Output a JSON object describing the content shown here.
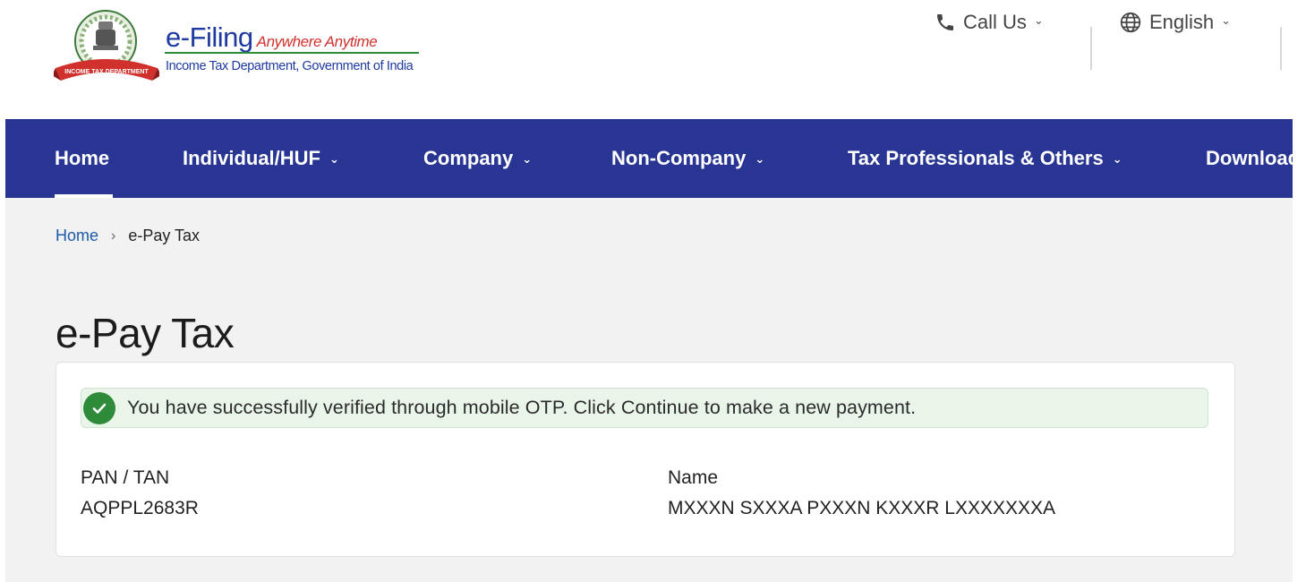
{
  "header": {
    "logo": {
      "title": "e-Filing",
      "tagline": "Anywhere Anytime",
      "subtitle": "Income Tax Department, Government of India",
      "ribbon_text": "INCOME TAX DEPARTMENT"
    },
    "actions": {
      "call_us": "Call Us",
      "language": "English"
    }
  },
  "nav": {
    "items": [
      {
        "label": "Home",
        "has_dropdown": false,
        "active": true
      },
      {
        "label": "Individual/HUF",
        "has_dropdown": true
      },
      {
        "label": "Company",
        "has_dropdown": true
      },
      {
        "label": "Non-Company",
        "has_dropdown": true
      },
      {
        "label": "Tax Professionals & Others",
        "has_dropdown": true
      },
      {
        "label": "Downloads",
        "has_dropdown": false
      }
    ]
  },
  "breadcrumb": {
    "home": "Home",
    "current": "e-Pay Tax"
  },
  "page": {
    "title": "e-Pay Tax"
  },
  "alert": {
    "message": "You have successfully verified through mobile OTP. Click Continue to make a new payment."
  },
  "details": {
    "pan_label": "PAN / TAN",
    "pan_value": "AQPPL2683R",
    "name_label": "Name",
    "name_value": "MXXXN SXXXA PXXXN KXXXR LXXXXXXXA"
  },
  "colors": {
    "nav_bg": "#283593",
    "link": "#1a5aa8",
    "success": "#2e8b3a",
    "content_bg": "#f2f2f2"
  }
}
